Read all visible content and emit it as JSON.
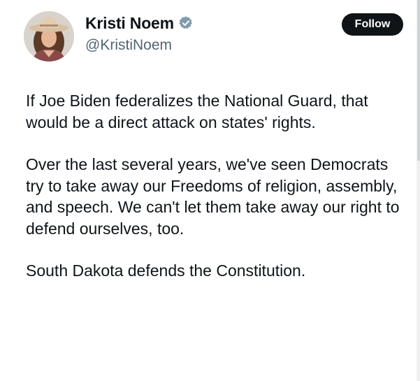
{
  "author": {
    "display_name": "Kristi Noem",
    "handle": "@KristiNoem",
    "verified_icon": "verified-badge-icon"
  },
  "follow_button": {
    "label": "Follow"
  },
  "tweet": {
    "paragraphs": [
      "If Joe Biden federalizes the National Guard, that would be a direct attack on states' rights.",
      "Over the last several years, we've seen Democrats try to take away our Freedoms of religion, assembly, and speech. We can't let them take away our right to defend ourselves, too.",
      "South Dakota defends the Constitution."
    ]
  },
  "colors": {
    "text_primary": "#0f1419",
    "text_secondary": "#536471",
    "follow_bg": "#0f1419",
    "verified_badge": "#829aab"
  }
}
